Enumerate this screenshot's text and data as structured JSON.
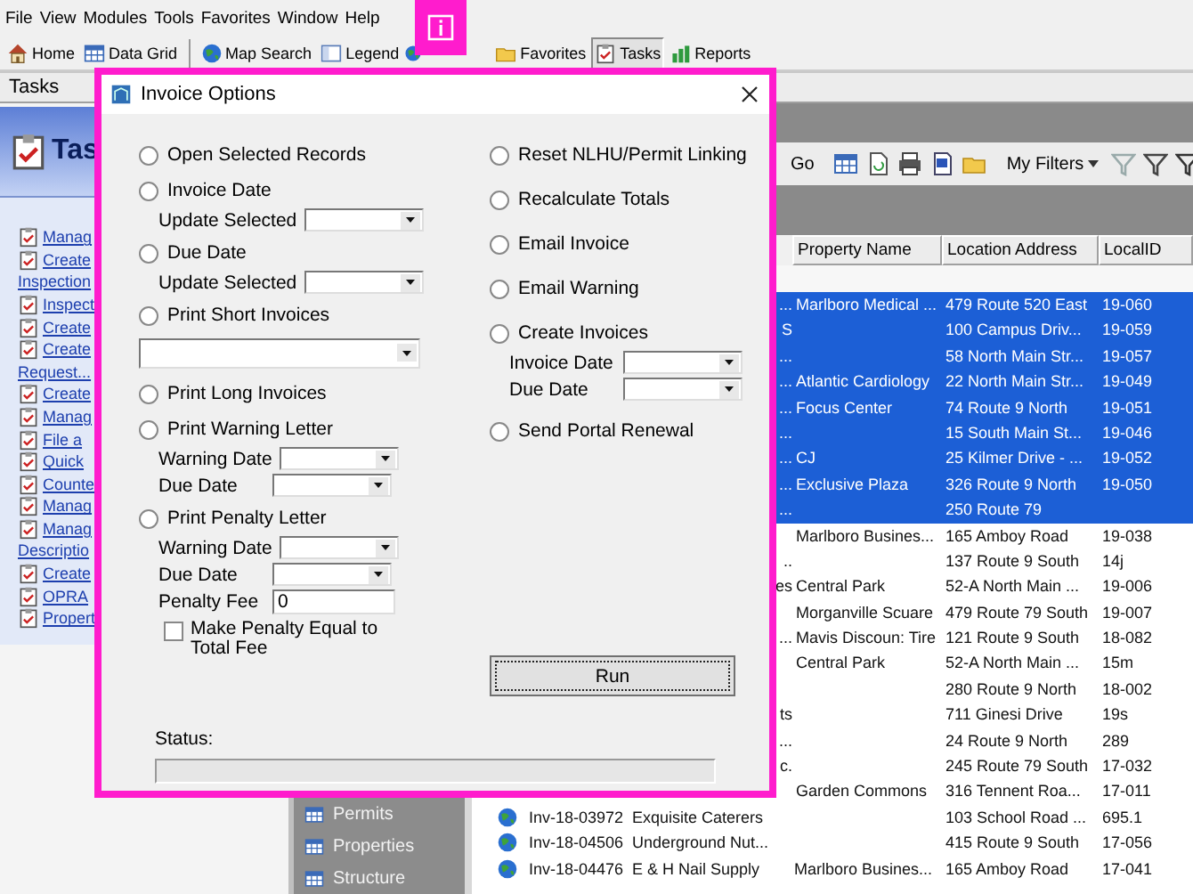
{
  "menu_bar": [
    "File",
    "View",
    "Modules",
    "Tools",
    "Favorites",
    "Window",
    "Help"
  ],
  "toolbar": [
    {
      "kind": "home",
      "label": "Home",
      "selected": false
    },
    {
      "kind": "grid",
      "label": "Data Grid",
      "selected": false
    },
    {
      "kind": "separator"
    },
    {
      "kind": "globe",
      "label": "Map Search",
      "selected": false
    },
    {
      "kind": "legend",
      "label": "Legend",
      "selected": false
    },
    {
      "kind": "globe",
      "selected": false
    },
    {
      "kind": "favorites",
      "label": "Favorites",
      "selected": false
    },
    {
      "kind": "tasks",
      "label": "Tasks",
      "selected": true
    },
    {
      "kind": "reports",
      "label": "Reports",
      "selected": false
    }
  ],
  "workspace_tab": {
    "title": "Tasks"
  },
  "task_panel": {
    "heading": "Tas",
    "links": [
      {
        "text": "Manag"
      },
      {
        "text": "Create",
        "continuation": "Inspection"
      },
      {
        "text": "Inspect"
      },
      {
        "text": "Create"
      },
      {
        "text": "Create",
        "continuation": "Request..."
      },
      {
        "text": "Create"
      },
      {
        "text": "Manag"
      },
      {
        "text": "File a"
      },
      {
        "text": "Quick"
      },
      {
        "text": "Counte"
      },
      {
        "text": "Manag"
      },
      {
        "text": "Manag",
        "continuation": "Descriptio"
      },
      {
        "text": "Create"
      },
      {
        "text": "OPRA"
      },
      {
        "text": "Propert"
      }
    ]
  },
  "nav_items": [
    "Permits",
    "Properties",
    "Structure"
  ],
  "grid": {
    "toolbar": {
      "go_button": "Go",
      "filters_menu": "My Filters"
    },
    "columns": [
      "Property Name",
      "Location Address",
      "LocalID"
    ],
    "rows": [
      {
        "name": "...",
        "property": "Marlboro Medical ...",
        "address": "479 Route 520 East",
        "local_id": "19-060",
        "selected": true
      },
      {
        "name": "S",
        "address": "100 Campus Driv...",
        "local_id": "19-059",
        "selected": true
      },
      {
        "name": "...",
        "address": "58 North Main Str...",
        "local_id": "19-057",
        "selected": true
      },
      {
        "name": "...",
        "property": "Atlantic Cardiology",
        "address": "22 North Main Str...",
        "local_id": "19-049",
        "selected": true
      },
      {
        "name": "...",
        "property": "Focus Center",
        "address": "74 Route 9 North",
        "local_id": "19-051",
        "selected": true
      },
      {
        "name": "...",
        "address": "15 South Main St...",
        "local_id": "19-046",
        "selected": true
      },
      {
        "name": "...",
        "property": "CJ",
        "address": "25 Kilmer Drive - ...",
        "local_id": "19-052",
        "selected": true
      },
      {
        "name": "...",
        "property": "Exclusive Plaza",
        "address": "326 Route 9 North",
        "local_id": "19-050",
        "selected": true
      },
      {
        "name": "...",
        "address": "250 Route 79",
        "selected": true
      },
      {
        "property": "Marlboro Busines...",
        "address": "165 Amboy Road",
        "local_id": "19-038",
        "selected": false
      },
      {
        "name": "..",
        "address": "137 Route 9 South",
        "local_id": "14j",
        "selected": false
      },
      {
        "name": "es",
        "property": "Central Park",
        "address": "52-A North Main ...",
        "local_id": "19-006",
        "selected": false
      },
      {
        "property": "Morganville Scuare",
        "address": "479 Route 79 South",
        "local_id": "19-007",
        "selected": false
      },
      {
        "name": "...",
        "property": "Mavis Discoun: Tire",
        "address": "121 Route 9 South",
        "local_id": "18-082",
        "selected": false
      },
      {
        "property": "Central Park",
        "address": "52-A North Main ...",
        "local_id": "15m",
        "selected": false
      },
      {
        "address": "280 Route 9 North",
        "local_id": "18-002",
        "selected": false
      },
      {
        "name": "ts",
        "address": "711 Ginesi Drive",
        "local_id": "19s",
        "selected": false
      },
      {
        "name": "...",
        "address": "24 Route 9 North",
        "local_id": "289",
        "selected": false
      },
      {
        "name": "c.",
        "address": "245 Route 79 South",
        "local_id": "17-032",
        "selected": false
      },
      {
        "property": "Garden Commons",
        "address": "316 Tennent Roa...",
        "local_id": "17-011",
        "selected": false
      },
      {
        "invoice": "Inv-18-03972",
        "name": "Exquisite Caterers",
        "address": "103 School Road ...",
        "local_id": "695.1",
        "selected": false
      },
      {
        "invoice": "Inv-18-04506",
        "name": "Underground Nut...",
        "address": "415 Route 9 South",
        "local_id": "17-056",
        "selected": false
      },
      {
        "invoice": "Inv-18-04476",
        "name": "E & H Nail Supply",
        "property": "Marlboro Busines...",
        "address": "165 Amboy Road",
        "local_id": "17-041",
        "selected": false
      }
    ]
  },
  "dialog": {
    "title": "Invoice Options",
    "left_options": [
      {
        "label": "Open Selected Records",
        "selected": false
      },
      {
        "label": "Invoice Date",
        "selected": false,
        "fields": [
          {
            "kind": "dropdown",
            "label": "Update Selected"
          }
        ]
      },
      {
        "label": "Due Date",
        "selected": false,
        "fields": [
          {
            "kind": "dropdown",
            "label": "Update Selected"
          }
        ]
      },
      {
        "label": "Print Short Invoices",
        "selected": false,
        "fields": [
          {
            "kind": "wide_dropdown"
          }
        ]
      },
      {
        "label": "Print Long Invoices",
        "selected": false
      },
      {
        "label": "Print Warning Letter",
        "selected": false,
        "fields": [
          {
            "kind": "dropdown",
            "label": "Warning Date"
          },
          {
            "kind": "dropdown",
            "label": "Due Date"
          }
        ]
      },
      {
        "label": "Print Penalty Letter",
        "selected": false,
        "fields": [
          {
            "kind": "dropdown",
            "label": "Warning Date"
          },
          {
            "kind": "dropdown",
            "label": "Due Date"
          },
          {
            "kind": "text",
            "label": "Penalty Fee",
            "value": "0"
          },
          {
            "kind": "checkbox",
            "label": "Make Penalty Equal to Total Fee",
            "checked": false
          }
        ]
      }
    ],
    "right_options": [
      {
        "label": "Reset NLHU/Permit Linking",
        "selected": false
      },
      {
        "label": "Recalculate Totals",
        "selected": false
      },
      {
        "label": "Email Invoice",
        "selected": false
      },
      {
        "label": "Email Warning",
        "selected": false
      },
      {
        "label": "Create Invoices",
        "selected": false,
        "fields": [
          {
            "kind": "dropdown",
            "label": "Invoice Date"
          },
          {
            "kind": "dropdown",
            "label": "Due Date"
          }
        ]
      },
      {
        "label": "Send Portal Renewal",
        "selected": false
      }
    ],
    "run_button": "Run",
    "status_label": "Status:"
  }
}
